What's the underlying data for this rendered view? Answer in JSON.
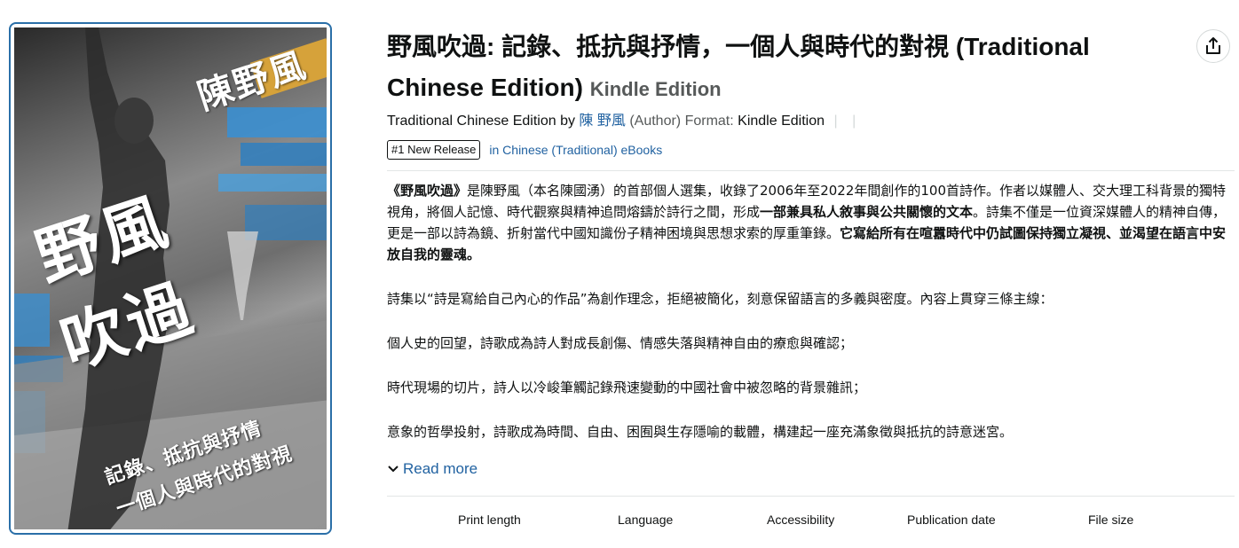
{
  "cover": {
    "author": "陳野風",
    "title_line1": "野風",
    "title_line2": "吹過",
    "subtitle_line1": "記錄、抵抗與抒情",
    "subtitle_line2": "一個人與時代的對視"
  },
  "product": {
    "title": "野風吹過: 記錄、抵抗與抒情，一個人與時代的對視 (Traditional Chinese Edition)",
    "format_label": "Kindle Edition",
    "byline_prefix": "Traditional Chinese Edition by",
    "author_link": "陳 野風",
    "author_role": "(Author)",
    "format_prefix": "Format:",
    "format_value": "Kindle Edition"
  },
  "badge": {
    "label": "#1 New Release",
    "category": "in Chinese (Traditional) eBooks"
  },
  "description": {
    "p1_part1": "《野風吹過》",
    "p1_part2": "是陳野風（本名陳國湧）的首部個人選集，收錄了2006年至2022年間創作的100首詩作。作者以媒體人、交大理工科背景的獨特視角，將個人記憶、時代觀察與精神追問熔鑄於詩行之間，形成",
    "p1_part3": "一部兼具私人敘事與公共關懷的文本",
    "p1_part4": "。詩集不僅是一位資深媒體人的精神自傳，更是一部以詩為鏡、折射當代中國知識份子精神困境與思想求索的厚重筆錄。",
    "p1_part5": "它寫給所有在喧囂時代中仍試圖保持獨立凝視、並渴望在語言中安放自我的靈魂。",
    "p2": "詩集以“詩是寫給自己內心的作品”為創作理念，拒絕被簡化，刻意保留語言的多義與密度。內容上貫穿三條主線：",
    "p3": "個人史的回望，詩歌成為詩人對成長創傷、情感失落與精神自由的療愈與確認；",
    "p4": "時代現場的切片，詩人以冷峻筆觸記錄飛速變動的中國社會中被忽略的背景雜訊；",
    "p5": "意象的哲學投射，詩歌成為時間、自由、困囿與生存隱喻的載體，構建起一座充滿象徵與抵抗的詩意迷宮。",
    "read_more": "Read more"
  },
  "carousel": {
    "items": [
      "Print length",
      "Language",
      "Accessibility",
      "Publication date",
      "File size"
    ]
  },
  "icons": {
    "share": "share-icon",
    "chevron": "chevron-down-icon"
  },
  "colors": {
    "link": "#2162a1",
    "cover_border": "#2a6fa8",
    "cover_accent_blue": "#3b8fd0",
    "cover_accent_gold": "#d6a23a"
  }
}
